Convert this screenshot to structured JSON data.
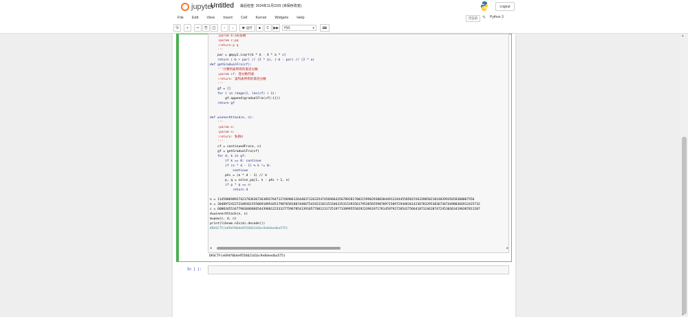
{
  "header": {
    "logo_text": "jupyter",
    "notebook_title": "Untitled",
    "checkpoint": "最后检查: 2024年11月23日  (未保存改变)",
    "logout_label": "Logout"
  },
  "menu": [
    "File",
    "Edit",
    "View",
    "Insert",
    "Cell",
    "Kernel",
    "Widgets",
    "Help"
  ],
  "kernel": {
    "trusted_label": "可信的",
    "kernel_name": "Python 3"
  },
  "toolbar": {
    "save": "🖫",
    "add": "+",
    "cut": "✂",
    "copy": "⎘",
    "paste": "📋",
    "up": "↑",
    "down": "↓",
    "run_label": "▶ 运行",
    "stop": "■",
    "restart": "C",
    "rerun": "▶▶",
    "celltype": "代码",
    "celltype_arrow": "▾",
    "keyboard": "⌨"
  },
  "code_lines": [
    "    :param b:a的系数",
    "    :param c:pq",
    "    :return:p q",
    "    '''",
    "    par = gmpy2.isqrt(b * b - 4 * a * c)",
    "    return (-b + par) // (2 * a), (-b - par) // (2 * a)",
    "def getGradualFra(cf):",
    "    '''计算列表所有的渐近分数",
    "    :param cf: 连分数列表",
    "    :return: 该列表所有的渐近分数",
    "    '''",
    "    gf = []",
    "    for i in range(1, len(cf) + 1):",
    "        gf.append(gradualFra(cf[:i]))",
    "    return gf",
    "",
    "",
    "def wienerAttack(e, n):",
    "    '''",
    "    :param e:",
    "    :param n:",
    "    :return: 私钥d",
    "    '''",
    "    cf = continuedFra(e, n)",
    "    gf = getGradualFra(cf)",
    "    for d, k in gf:",
    "        if k == 0: continue",
    "        if (e * d - 1) % k != 0:",
    "            continue",
    "        phi = (e * d - 1) // k",
    "        p, q = solve_pq(1, n - phi + 1, n)",
    "        if p * q == n:",
    "            return d",
    "",
    "n = 114590698927421783636736389276471274690612644037126335474569664356789281700215990293803044912244455850155633905021014839935658380067556",
    "e = 204897242272109361555869189544517987658180744667541922182153346335315393561795385655987097150972944816142367832953036736744980366912425732",
    "c = 600034553477903686866544396012233327759678541391057706123172519773389955502923396197178145979272054275664187324620747245303634190387811207",
    "d=wienerAttack(e, n)",
    "m=pow(c, d, n)",
    "print(libnum.n2s(m).decode())",
    "#DASCTF{e694f0b4e9556021d1bc9e8deedba575}"
  ],
  "output_text": "DASCTF{e694f0b4e9556021d1bc9e8deedba575}",
  "empty_prompt": "In  [ ]:",
  "scroll": {
    "left": "◂",
    "right": "▸",
    "up": "▴",
    "down": "▾"
  }
}
